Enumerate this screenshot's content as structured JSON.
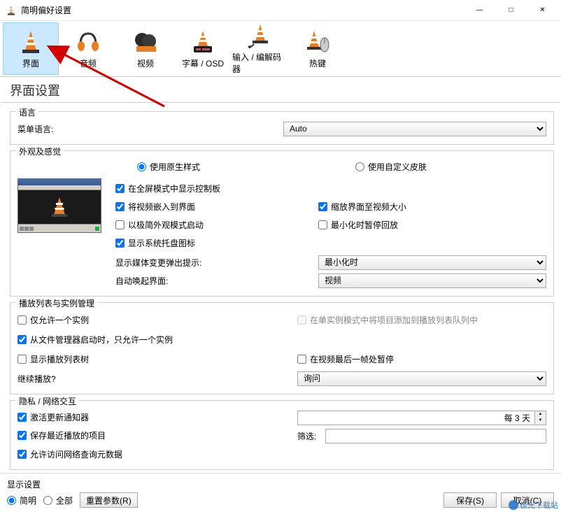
{
  "window": {
    "title": "简明偏好设置"
  },
  "categories": [
    {
      "label": "界面",
      "selected": true
    },
    {
      "label": "音频",
      "selected": false
    },
    {
      "label": "视频",
      "selected": false
    },
    {
      "label": "字幕 / OSD",
      "selected": false
    },
    {
      "label": "输入 / 编解码器",
      "selected": false
    },
    {
      "label": "热键",
      "selected": false
    }
  ],
  "page_title": "界面设置",
  "groups": {
    "language": {
      "title": "语言",
      "menu_language_label": "菜单语言:",
      "menu_language_value": "Auto"
    },
    "look_feel": {
      "title": "外观及感觉",
      "radio_native": "使用原生样式",
      "radio_custom": "使用自定义皮肤",
      "opt_fullscreen_ctrl": "在全屏模式中显示控制板",
      "opt_embed_video": "将视频嵌入到界面",
      "opt_minimal_start": "以极简外观模式启动",
      "opt_systray": "显示系统托盘图标",
      "opt_resize_to_video": "缩放界面至视频大小",
      "opt_pause_minimize": "最小化时暂停回放",
      "media_change_label": "显示媒体变更弹出提示:",
      "media_change_value": "最小化时",
      "auto_raise_label": "自动唤起界面:",
      "auto_raise_value": "视频"
    },
    "playlist": {
      "title": "播放列表与实例管理",
      "one_instance": "仅允许一个实例",
      "enqueue_single": "在单实例模式中将项目添加到播放列表队列中",
      "file_mgr_single": "从文件管理器启动时，只允许一个实例",
      "show_tree": "显示播放列表树",
      "pause_last_frame": "在视频最后一帧处暂停",
      "continue_label": "继续播放?",
      "continue_value": "询问"
    },
    "privacy": {
      "title": "隐私 / 网络交互",
      "update_notifier": "激活更新通知器",
      "update_interval": "每 3 天",
      "save_recent": "保存最近播放的项目",
      "filter_label": "筛选:",
      "filter_value": "",
      "allow_meta": "允许访问网络查询元数据"
    }
  },
  "footer": {
    "show_settings_label": "显示设置",
    "simple": "简明",
    "all": "全部",
    "reset": "重置参数(R)",
    "save": "保存(S)",
    "cancel": "取消(C)"
  },
  "watermark": "极光下载站"
}
